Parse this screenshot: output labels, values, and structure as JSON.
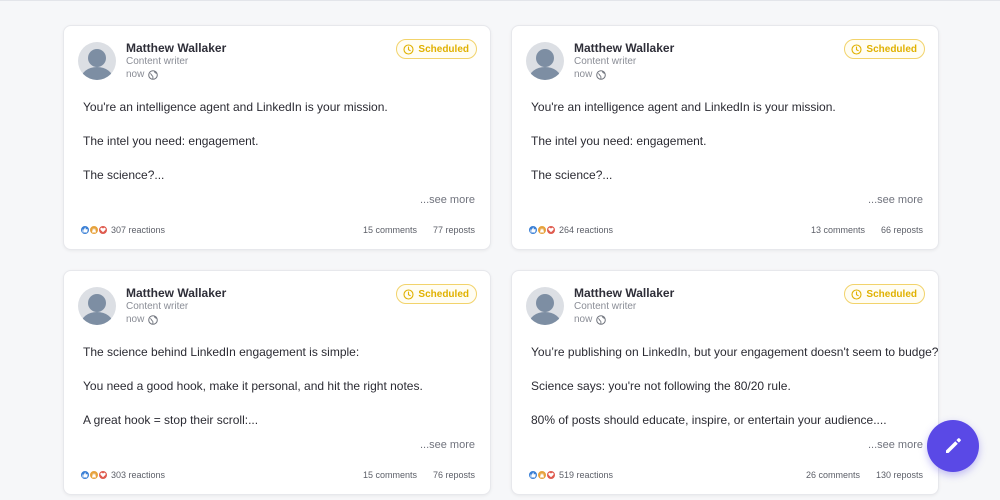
{
  "colors": {
    "accent": "#5a49e6",
    "scheduled": "#e0b100",
    "like": "#3a7fd5",
    "clap": "#e6a23c",
    "love": "#df5a4e"
  },
  "posts": [
    {
      "author": "Matthew Wallaker",
      "role": "Content writer",
      "time": "now",
      "status": "Scheduled",
      "lines": [
        "You're an intelligence agent and LinkedIn is your mission.",
        "The intel you need: engagement.",
        "The science?..."
      ],
      "see_more": "...see more",
      "reactions": "307 reactions",
      "comments": "15 comments",
      "reposts": "77 reposts"
    },
    {
      "author": "Matthew Wallaker",
      "role": "Content writer",
      "time": "now",
      "status": "Scheduled",
      "lines": [
        "You're an intelligence agent and LinkedIn is your mission.",
        "The intel you need: engagement.",
        "The science?..."
      ],
      "see_more": "...see more",
      "reactions": "264 reactions",
      "comments": "13 comments",
      "reposts": "66 reposts"
    },
    {
      "author": "Matthew Wallaker",
      "role": "Content writer",
      "time": "now",
      "status": "Scheduled",
      "lines": [
        "The science behind LinkedIn engagement is simple:",
        "You need a good hook, make it personal, and hit the right notes.",
        "A great hook = stop their scroll:..."
      ],
      "see_more": "...see more",
      "reactions": "303 reactions",
      "comments": "15 comments",
      "reposts": "76 reposts"
    },
    {
      "author": "Matthew Wallaker",
      "role": "Content writer",
      "time": "now",
      "status": "Scheduled",
      "lines": [
        "You’re publishing on LinkedIn, but your engagement doesn't seem to budge?",
        "Science says: you're not following the 80/20 rule.",
        "80% of posts should educate, inspire, or entertain your audience...."
      ],
      "see_more": "...see more",
      "reactions": "519 reactions",
      "comments": "26 comments",
      "reposts": "130 reposts"
    }
  ],
  "fab": {
    "icon": "pencil-icon"
  }
}
